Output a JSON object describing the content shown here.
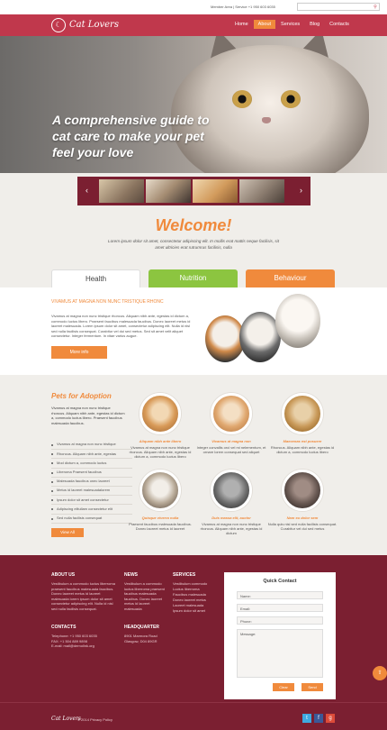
{
  "topbar": {
    "contact_info": "Member Area | Service +1 950 603 6035",
    "search_icon": "search-icon"
  },
  "header": {
    "logo_text": "Cat Lovers",
    "logo_icon": "cat-head-icon",
    "nav": [
      "Home",
      "About",
      "Services",
      "Blog",
      "Contacts"
    ],
    "active_nav": "About"
  },
  "hero": {
    "headline": "A comprehensive guide to cat care to make your pet feel your love"
  },
  "thumbs": {
    "prev_icon": "chevron-left-icon",
    "next_icon": "chevron-right-icon"
  },
  "welcome": {
    "title": "Welcome!",
    "text": "Lorem ipsum dolor sit amet, consectetur adipiscing elit. In mollis erat mattis neque facilisis, sit amet ultricies erat rutrumrus facilisis, nulla"
  },
  "tabs": [
    "Health",
    "Nutrition",
    "Behaviour"
  ],
  "tab_panel": {
    "heading": "VIVAMUS AT MAGNA NON NUNC TRISTIQUE RHONC",
    "text": "Vivamus at magna non nunc tristique rhoncus. Aliquam nibh ante, egestas id dictum a, commodo luctus libero. Praesent faucibus malesuada faucibus. Donec laoreet metus id laoreet malesuada. Lorem ipsum dolor sit amet, consectetur adipiscing elit. Nulla id nisl sed nulla facilisis consequat. Curabitur vel dui sed metus. Sed sit amet velit aliquet consectetur. Integer fermentum. In vitae varius augue.",
    "button": "More info"
  },
  "adoption": {
    "title": "Pets for Adoption",
    "intro": "Vivamus at magna non nunc tristique rhoncus. Aliquam nibh ante, egestas id dictum a, commodo luctus libero. Praesent faucibus malesuada faucibus.",
    "list": [
      "Vivamus at magna non nunc tristique",
      "Rhoncus. Aliquam nibh ante, egestas",
      "Mod dictum a, commodo luctus",
      "Liberoma Praesent faucibus",
      "Malesuada faucibus onec laoreet",
      "Metus id laoreet malesuadalorem",
      "Ipsum dolor sit amet consectetur",
      "Adipiscing elitullam consectetur elit",
      "Sed nulla facilisis consequat"
    ],
    "view_all": "View All",
    "pets": [
      {
        "name": "Aliquam nibh ante libero",
        "desc": "Vivamus at magna non nunc tristique rhoncus. Aliquam nibh ante, egestas id dictum a, commodo luctus libero"
      },
      {
        "name": "Vivamus at magna non",
        "desc": "Integer convallis orci vel mi nelementum, et ornare lorem consequat sed aliquet"
      },
      {
        "name": "Maecenas est posuere",
        "desc": "Rhoncus. Aliquam nibh ante, egestas id dictum a, commodo luctus libero"
      },
      {
        "name": "Quisque viverra nulla",
        "desc": "Praesent faucibus malesuada faucibus. Donec laoreet metus id laoreet"
      },
      {
        "name": "Duis massa elit, auctor",
        "desc": "Vivamus at magna non nunc tristique rhoncus. Aliquam nibh ante, egestas id dictum"
      },
      {
        "name": "Nam eu dolor sem",
        "desc": "Nulla quis nisl sed nulla facilisis consequat. Curabitur vel dui sed metus"
      }
    ]
  },
  "footer": {
    "about_title": "ABOUT US",
    "about_text": "Vestibulum a commodo luctus liberroma praesent faucibus malesuada faucibus. Donec laoreet metus id laoreet malesuada lorem ipsum dolor sit amet consectetur adipiscing elit. Nulla id nisl sed nulla facilisis consequat.",
    "contacts_title": "CONTACTS",
    "contacts_text": "Telephone: +1 950 603 6035\nFAX: +1 504 889 9898\nE-mail: mail@demolink.org",
    "news_title": "NEWS",
    "news_text": "Vestibulum a commodo luctus liberroma praesent faucibus malesuada faucibus. Donec laoreet metus id laoreet malesuada",
    "hq_title": "HEADQUARTER",
    "hq_text": "8901 Marmora Road\nGlasgow, D04 89GR",
    "services_title": "SERVICES",
    "services_list": [
      "Vestibulum commodo",
      "Luctus liberroma",
      "Faucibus malesuada",
      "Donec laoreet metus",
      "Laoreet malesuada",
      "Ipsum dolor sit amet"
    ],
    "quick_contact": {
      "title": "Quick Contact",
      "name_placeholder": "Name:",
      "email_placeholder": "Email:",
      "phone_placeholder": "Phone:",
      "message_placeholder": "Message:",
      "clear": "Clear",
      "send": "Send"
    },
    "bottom_logo": "Cat Lovers",
    "copyright": "© 2014 Privacy Policy",
    "social_colors": [
      "#3fa9e0",
      "#3b5998",
      "#dd4b39"
    ]
  },
  "colors": {
    "brand": "#c0384c",
    "accent": "#f08a3c",
    "footer": "#7b1f31",
    "nutrition": "#8cc540"
  }
}
